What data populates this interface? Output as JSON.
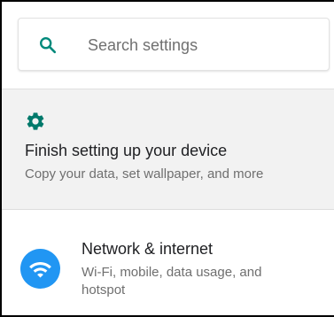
{
  "search": {
    "placeholder": "Search settings",
    "icon": "search-icon",
    "icon_color": "#00897b"
  },
  "suggestion": {
    "icon": "gear-icon",
    "icon_color": "#00796b",
    "title": "Finish setting up your device",
    "subtitle": "Copy your data, set wallpaper, and more"
  },
  "settings_items": [
    {
      "icon": "wifi-icon",
      "icon_bg": "#2196f3",
      "title": "Network & internet",
      "subtitle": "Wi-Fi, mobile, data usage, and hotspot"
    }
  ]
}
